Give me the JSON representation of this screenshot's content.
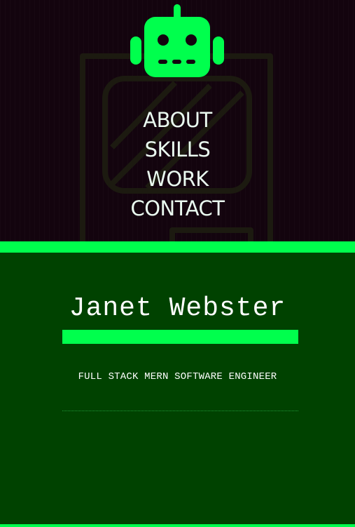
{
  "theme": {
    "header_bg": "#13040e",
    "accent": "#00ff4d",
    "hero_bg": "#004200",
    "nav_text": "#eafaf0",
    "text": "#ffffff"
  },
  "header": {
    "logo_icon": "robot-icon",
    "background_art": "tablet-device-outline"
  },
  "nav": {
    "items": [
      {
        "label": "ABOUT"
      },
      {
        "label": "SKILLS"
      },
      {
        "label": "WORK"
      },
      {
        "label": "CONTACT"
      }
    ]
  },
  "hero": {
    "name": "Janet Webster",
    "subtitle": "FULL STACK MERN SOFTWARE ENGINEER"
  }
}
